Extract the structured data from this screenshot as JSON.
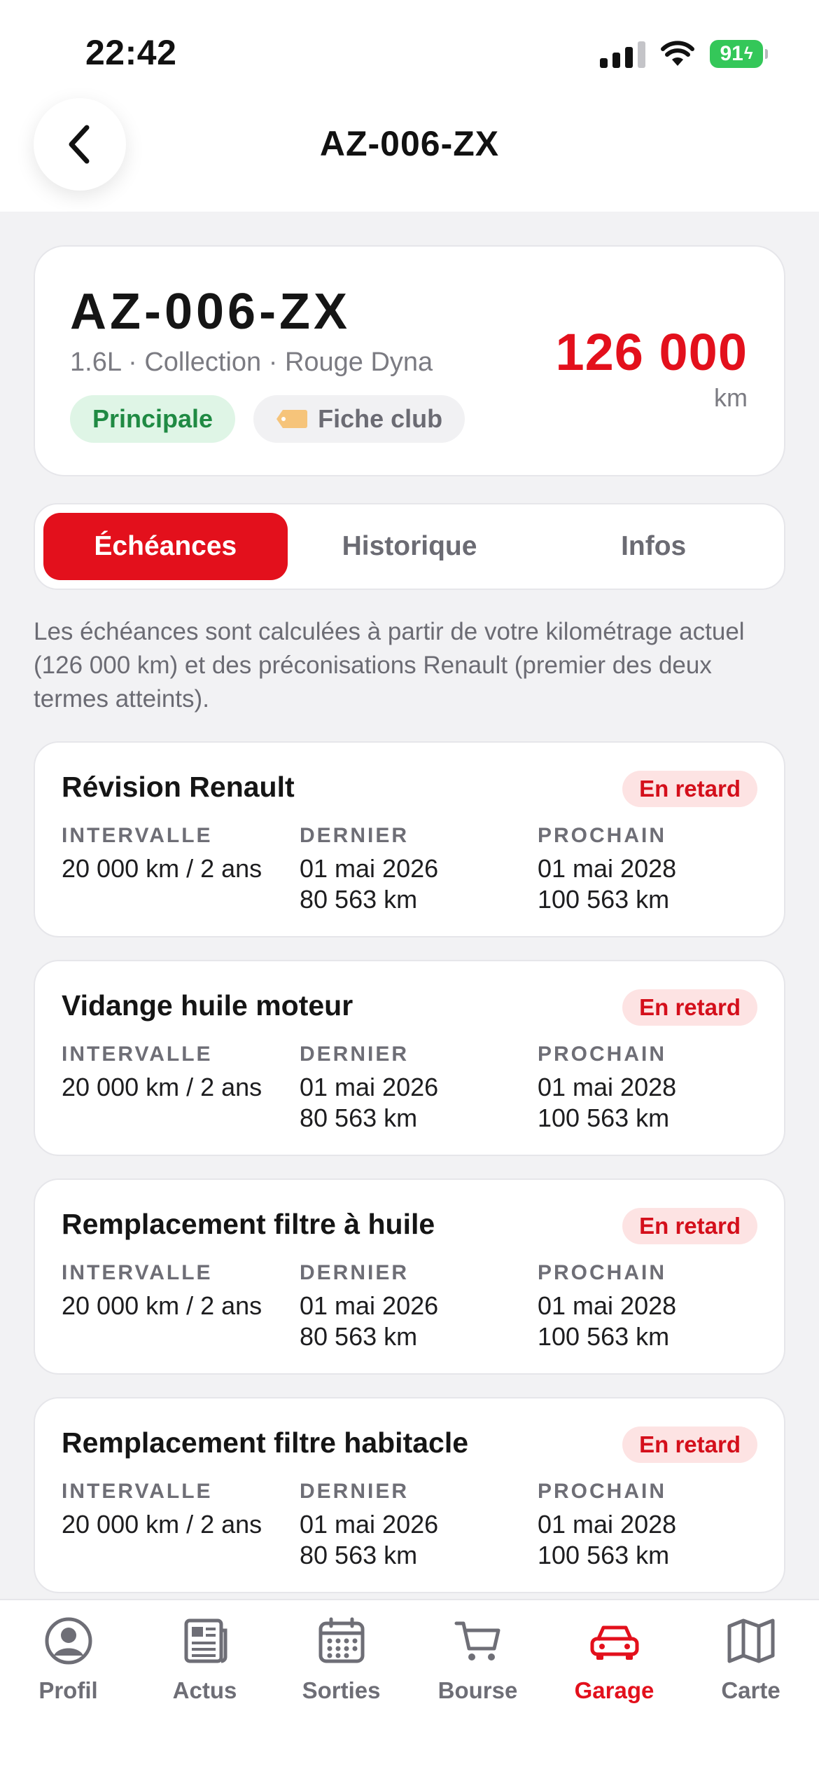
{
  "status_bar": {
    "time": "22:42",
    "battery": "91"
  },
  "header": {
    "title": "AZ-006-ZX"
  },
  "vehicle": {
    "plate": "AZ-006-ZX",
    "spec": "1.6L · Collection · Rouge Dyna",
    "badge_primary": "Principale",
    "badge_club": "Fiche club",
    "mileage": "126 000",
    "mileage_unit": "km"
  },
  "tabs": [
    {
      "label": "Échéances",
      "active": true
    },
    {
      "label": "Historique",
      "active": false
    },
    {
      "label": "Infos",
      "active": false
    }
  ],
  "info_text": "Les échéances sont calculées à partir de votre kilométrage actuel (126 000 km) et des préconisations Renault (premier des deux termes atteints).",
  "column_labels": {
    "interval": "INTERVALLE",
    "last": "DERNIER",
    "next": "PROCHAIN"
  },
  "maintenance": [
    {
      "title": "Révision Renault",
      "status": "En retard",
      "interval": "20 000 km / 2 ans",
      "last_date": "01 mai 2026",
      "last_km": "80 563 km",
      "next_date": "01 mai 2028",
      "next_km": "100 563 km"
    },
    {
      "title": "Vidange huile moteur",
      "status": "En retard",
      "interval": "20 000 km / 2 ans",
      "last_date": "01 mai 2026",
      "last_km": "80 563 km",
      "next_date": "01 mai 2028",
      "next_km": "100 563 km"
    },
    {
      "title": "Remplacement filtre à huile",
      "status": "En retard",
      "interval": "20 000 km / 2 ans",
      "last_date": "01 mai 2026",
      "last_km": "80 563 km",
      "next_date": "01 mai 2028",
      "next_km": "100 563 km"
    },
    {
      "title": "Remplacement filtre habitacle",
      "status": "En retard",
      "interval": "20 000 km / 2 ans",
      "last_date": "01 mai 2026",
      "last_km": "80 563 km",
      "next_date": "01 mai 2028",
      "next_km": "100 563 km"
    }
  ],
  "bottom_nav": [
    {
      "label": "Profil",
      "icon": "profile-icon",
      "active": false
    },
    {
      "label": "Actus",
      "icon": "news-icon",
      "active": false
    },
    {
      "label": "Sorties",
      "icon": "calendar-icon",
      "active": false
    },
    {
      "label": "Bourse",
      "icon": "cart-icon",
      "active": false
    },
    {
      "label": "Garage",
      "icon": "car-icon",
      "active": true
    },
    {
      "label": "Carte",
      "icon": "map-icon",
      "active": false
    }
  ],
  "colors": {
    "accent": "#e3101c",
    "success": "#1f8a43",
    "warning_bg": "#fde3e3",
    "background": "#f2f2f4"
  }
}
